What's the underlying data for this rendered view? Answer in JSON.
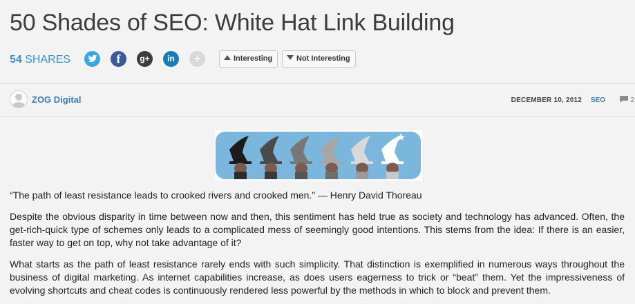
{
  "article": {
    "title": "50 Shades of SEO: White Hat Link Building",
    "author": "ZOG Digital",
    "date": "DECEMBER 10, 2012",
    "category": "SEO",
    "comment_count": "2",
    "quote": "“The path of least resistance leads to crooked rivers and crooked men.” — Henry David Thoreau",
    "paragraphs": [
      "Despite the obvious disparity in time between now and then, this sentiment has held true as society and technology has advanced. Often, the get-rich-quick type of schemes only leads to a complicated mess of seemingly good intentions. This stems from the idea: If there is an easier, faster way to get on top, why not take advantage of it?",
      "What starts as the path of least resistance rarely ends with such simplicity. That distinction is exemplified in numerous ways throughout the business of digital marketing. As internet capabilities increase, as does users eagerness to trick or “beat” them. Yet the impressiveness of evolving shortcuts and cheat codes is continuously rendered less powerful by the methods in which to block and prevent them."
    ]
  },
  "shares": {
    "count": "54",
    "label": "SHARES",
    "networks": [
      {
        "name": "twitter",
        "icon": "twitter-bird-icon",
        "color": "#3aa7e0"
      },
      {
        "name": "facebook",
        "icon": "facebook-f-icon",
        "glyph": "f",
        "color": "#3b5a9a"
      },
      {
        "name": "google-plus",
        "icon": "google-plus-icon",
        "glyph": "g+",
        "color": "#3d3d3d"
      },
      {
        "name": "linkedin",
        "icon": "linkedin-in-icon",
        "glyph": "in",
        "color": "#1b7cb5"
      },
      {
        "name": "more",
        "icon": "plus-icon",
        "glyph": "+",
        "color": "#d8d8d8"
      }
    ]
  },
  "voting": {
    "interesting": "Interesting",
    "not_interesting": "Not Interesting"
  },
  "hero_image": {
    "description_icon": "wizard-hats-banner",
    "hat_colors": [
      "#1c1c1c",
      "#4a4a4a",
      "#777777",
      "#a6a6a6",
      "#d9d9d9",
      "#ffffff"
    ],
    "background": "#7bb6dc"
  },
  "theme": {
    "link_color": "#3a7db8",
    "share_blue": "#3a8fc8"
  }
}
